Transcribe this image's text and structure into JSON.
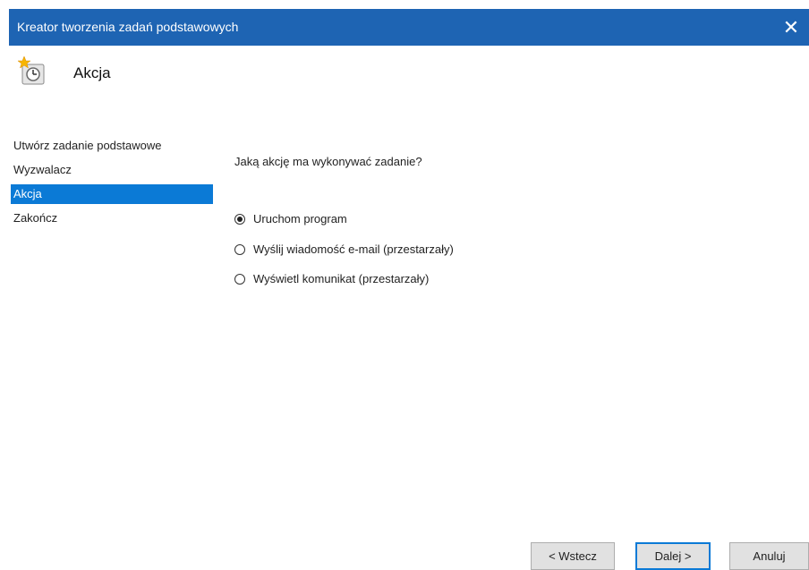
{
  "window": {
    "title": "Kreator tworzenia zadań podstawowych",
    "close_icon": "close-icon"
  },
  "header": {
    "icon": "task-scheduler-icon",
    "title": "Akcja"
  },
  "nav": {
    "items": [
      {
        "label": "Utwórz zadanie podstawowe",
        "active": false
      },
      {
        "label": "Wyzwalacz",
        "active": false
      },
      {
        "label": "Akcja",
        "active": true
      },
      {
        "label": "Zakończ",
        "active": false
      }
    ]
  },
  "main": {
    "question": "Jaką akcję ma wykonywać zadanie?",
    "options": [
      {
        "label": "Uruchom program",
        "selected": true
      },
      {
        "label": "Wyślij wiadomość e-mail (przestarzały)",
        "selected": false
      },
      {
        "label": "Wyświetl komunikat (przestarzały)",
        "selected": false
      }
    ]
  },
  "buttons": {
    "back": "< Wstecz",
    "next": "Dalej >",
    "cancel": "Anuluj"
  },
  "colors": {
    "titlebar": "#1e64b3",
    "selection": "#0b7ad6"
  }
}
